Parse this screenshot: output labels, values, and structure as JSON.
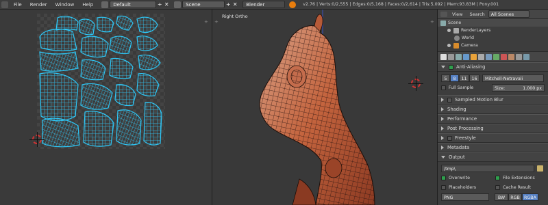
{
  "menu": [
    "File",
    "Render",
    "Window",
    "Help"
  ],
  "screen_layout": "Default",
  "scene_name": "Scene",
  "render_engine": "Blender Render",
  "stats": "v2.76 | Verts:0/2,555 | Edges:0/5,168 | Faces:0/2,614 | Tris:5,092 | Mem:93.83M | Pony.001",
  "viewport": {
    "title": "Right Ortho"
  },
  "outliner": {
    "tabs": [
      "View",
      "Search"
    ],
    "filter": "All Scenes",
    "rows": [
      {
        "label": "Scene",
        "icon_color": "#8aa",
        "icon": "scene-icon"
      },
      {
        "label": "RenderLayers",
        "icon_color": "#aaa",
        "icon": "renderlayers-icon"
      },
      {
        "label": "World",
        "icon_color": "#888",
        "icon": "world-icon"
      },
      {
        "label": "Camera",
        "icon_color": "#d98c2b",
        "icon": "camera-icon"
      }
    ]
  },
  "properties": {
    "antialiasing": {
      "label": "Anti-Aliasing",
      "samples": [
        "5",
        "8",
        "11",
        "16"
      ],
      "active_sample": "8",
      "filter": "Mitchell-Netravali",
      "full_sample": "Full Sample",
      "size_label": "Size:",
      "size_value": "1.000 px"
    },
    "panels": [
      {
        "label": "Sampled Motion Blur",
        "checkbox": true
      },
      {
        "label": "Shading",
        "checkbox": false
      },
      {
        "label": "Performance",
        "checkbox": false
      },
      {
        "label": "Post Processing",
        "checkbox": false
      },
      {
        "label": "Freestyle",
        "checkbox": true
      },
      {
        "label": "Metadata",
        "checkbox": false
      }
    ],
    "output": {
      "label": "Output",
      "path": "/tmp\\",
      "overwrite": "Overwrite",
      "file_extensions": "File Extensions",
      "placeholders": "Placeholders",
      "cache_result": "Cache Result",
      "format": "PNG",
      "color_modes": [
        "BW",
        "RGB",
        "RGBA"
      ],
      "active_color_mode": "RGBA"
    }
  },
  "colors": {
    "accent_blue": "#5680c2",
    "uv_wire": "#2ec6f5",
    "mesh_orange": "#c4643e"
  }
}
